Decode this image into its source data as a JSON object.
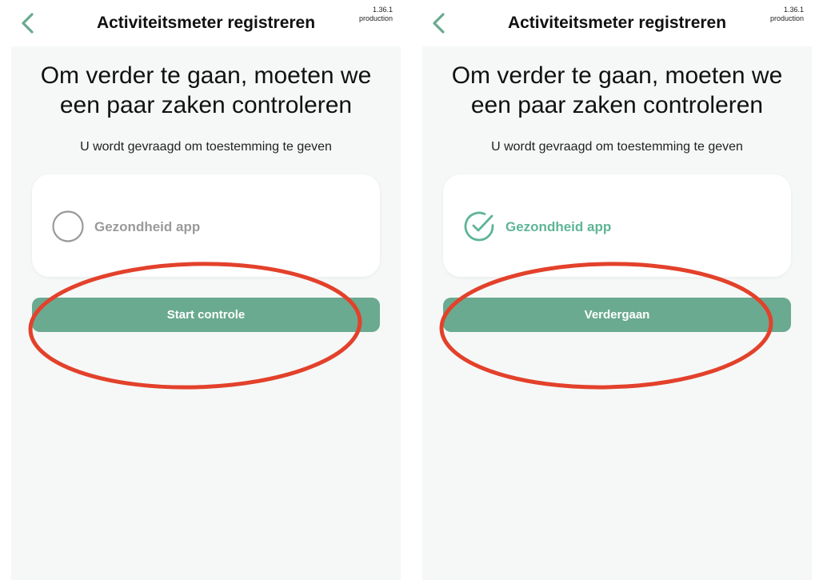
{
  "screens": [
    {
      "header": {
        "title": "Activiteitsmeter registreren",
        "version": "1.36.1",
        "environment": "production"
      },
      "heading": "Om verder te gaan, moeten we een paar zaken controleren",
      "subheading": "U wordt gevraagd om toestemming te geven",
      "permission": {
        "label": "Gezondheid app",
        "checked": false,
        "icon": "empty-circle-icon"
      },
      "button": {
        "label": "Start controle"
      }
    },
    {
      "header": {
        "title": "Activiteitsmeter registreren",
        "version": "1.36.1",
        "environment": "production"
      },
      "heading": "Om verder te gaan, moeten we een paar zaken controleren",
      "subheading": "U wordt gevraagd om toestemming te geven",
      "permission": {
        "label": "Gezondheid app",
        "checked": true,
        "icon": "check-circle-icon"
      },
      "button": {
        "label": "Verdergaan"
      }
    }
  ],
  "colors": {
    "accent": "#6aaa90",
    "check_green": "#5eb596",
    "annotation_red": "#e3412b",
    "background": "#f5f8f7"
  }
}
